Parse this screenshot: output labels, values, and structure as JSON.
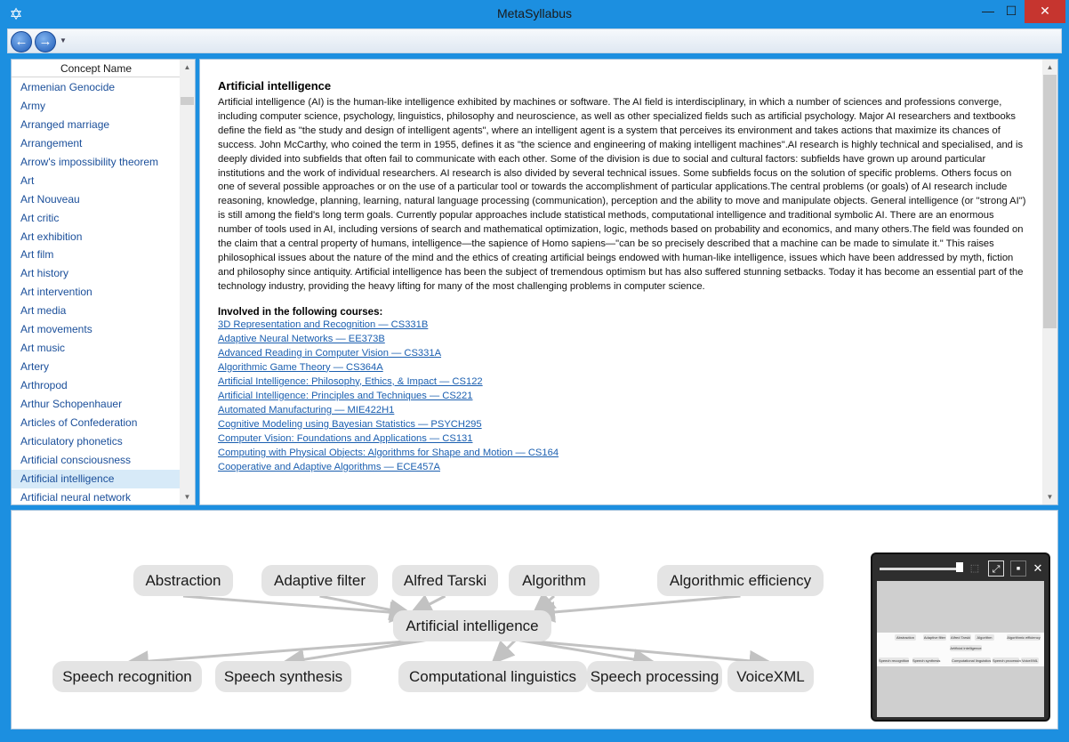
{
  "window": {
    "title": "MetaSyllabus",
    "min": "—",
    "max": "☐",
    "close": "✕",
    "icon": "star-of-david-icon"
  },
  "toolbar": {
    "back": "←",
    "forward": "→",
    "dropdown": "▼"
  },
  "list": {
    "header": "Concept Name",
    "items": [
      "Armenian Genocide",
      "Army",
      "Arranged marriage",
      "Arrangement",
      "Arrow's impossibility theorem",
      "Art",
      "Art Nouveau",
      "Art critic",
      "Art exhibition",
      "Art film",
      "Art history",
      "Art intervention",
      "Art media",
      "Art movements",
      "Art music",
      "Artery",
      "Arthropod",
      "Arthur Schopenhauer",
      "Articles of Confederation",
      "Articulatory phonetics",
      "Artificial consciousness",
      "Artificial intelligence",
      "Artificial neural network"
    ],
    "selected_index": 21,
    "scroll_up": "▲",
    "scroll_down": "▼"
  },
  "detail": {
    "title": "Artificial intelligence",
    "description": "Artificial intelligence (AI) is the human-like intelligence exhibited by machines or software. The AI field is interdisciplinary, in which a number of sciences and professions converge, including computer science, psychology, linguistics, philosophy and neuroscience, as well as other specialized fields such as artificial psychology. Major AI researchers and textbooks define the field as \"the study and design of intelligent agents\", where an intelligent agent is a system that perceives its environment and takes actions that maximize its chances of success. John McCarthy, who coined the term in 1955, defines it as \"the science and engineering of making intelligent machines\".AI research is highly technical and specialised, and is deeply divided into subfields that often fail to communicate with each other. Some of the division is due to social and cultural factors: subfields have grown up around particular institutions and the work of individual researchers. AI research is also divided by several technical issues. Some subfields focus on the solution of specific problems. Others focus on one of several possible approaches or on the use of a particular tool or towards the accomplishment of particular applications.The central problems (or goals) of AI research include reasoning, knowledge, planning, learning, natural language processing (communication), perception and the ability to move and manipulate objects. General intelligence (or \"strong AI\") is still among the field's long term goals. Currently popular approaches include statistical methods, computational intelligence and traditional symbolic AI. There are an enormous number of tools used in AI, including versions of search and mathematical optimization, logic, methods based on probability and economics, and many others.The field was founded on the claim that a central property of humans, intelligence—the sapience of Homo sapiens—\"can be so precisely described that a machine can be made to simulate it.\" This raises philosophical issues about the nature of the mind and the ethics of creating artificial beings endowed with human-like intelligence, issues which have been addressed by myth, fiction and philosophy since antiquity. Artificial intelligence has been the subject of tremendous optimism but has also suffered stunning setbacks. Today it has become an essential part of the technology industry, providing the heavy lifting for many of the most challenging problems in computer science.",
    "courses_heading": "Involved in the following courses:",
    "courses": [
      "3D Representation and Recognition — CS331B",
      "Adaptive Neural Networks — EE373B",
      "Advanced Reading in Computer Vision — CS331A",
      "Algorithmic Game Theory — CS364A",
      "Artificial Intelligence: Philosophy, Ethics, & Impact  — CS122",
      "Artificial Intelligence: Principles and Techniques — CS221",
      "Automated Manufacturing — MIE422H1",
      "Cognitive Modeling using Bayesian Statistics — PSYCH295",
      "Computer Vision: Foundations and Applications — CS131",
      "Computing with Physical Objects: Algorithms for Shape and Motion — CS164",
      "Cooperative and Adaptive Algorithms — ECE457A"
    ],
    "scroll_up": "▲",
    "scroll_down": "▼"
  },
  "graph": {
    "center": "Artificial intelligence",
    "incoming": [
      "Abstraction",
      "Adaptive filter",
      "Alfred Tarski",
      "Algorithm",
      "Algorithmic efficiency"
    ],
    "outgoing": [
      "Speech recognition",
      "Speech synthesis",
      "Computational linguistics",
      "Speech processing",
      "VoiceXML"
    ]
  },
  "minimap": {
    "fit": "⤢",
    "stop": "■",
    "close": "✕",
    "frame": "⬚"
  }
}
